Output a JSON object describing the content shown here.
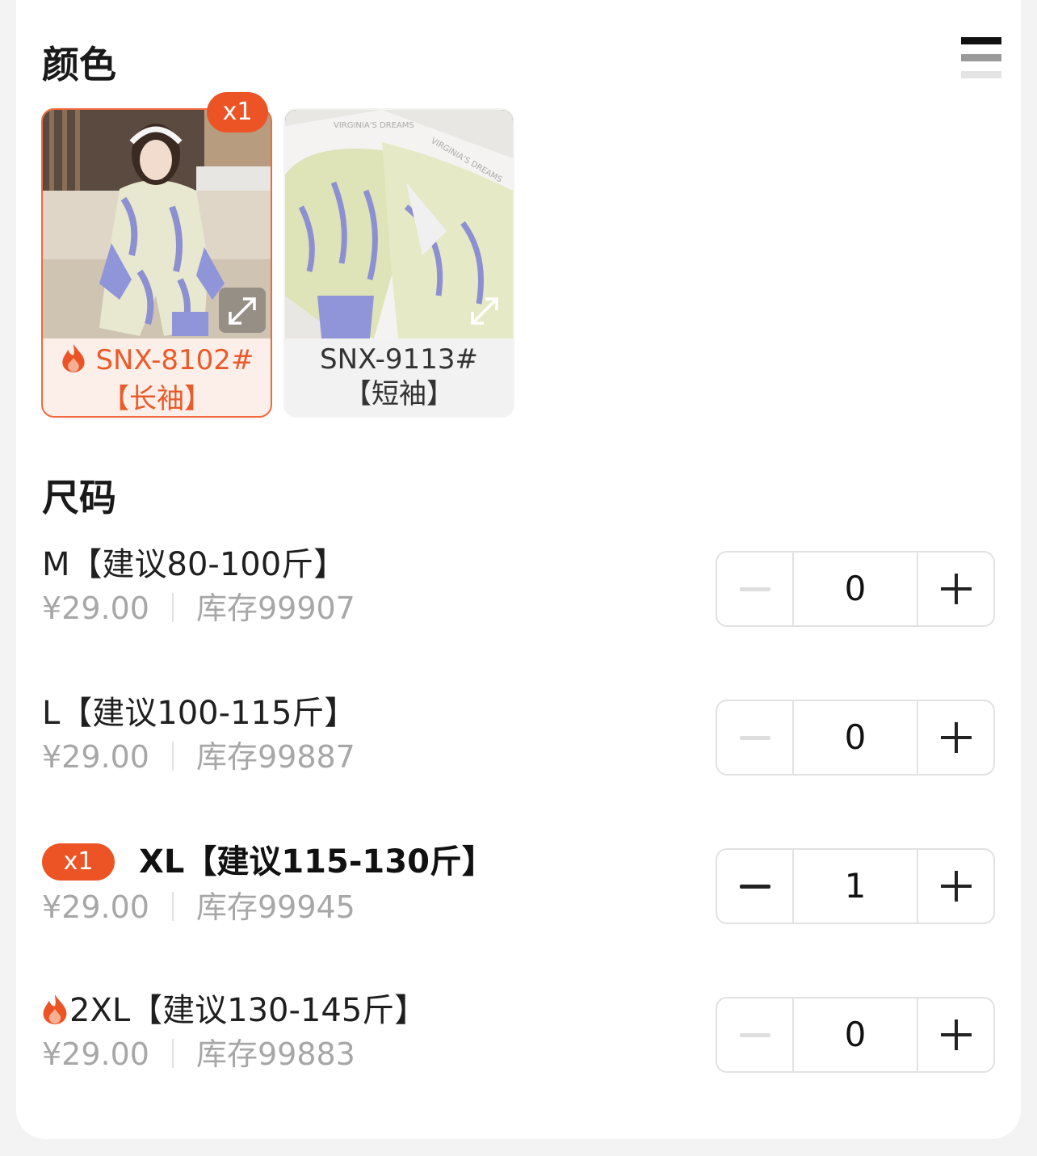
{
  "color_section": {
    "title": "颜色",
    "options": [
      {
        "label_line1": "SNX-8102#",
        "label_line2": "【长袖】",
        "selected": true,
        "count_badge": "x1",
        "hot": true,
        "image": "model-in-long-sleeve-pajamas"
      },
      {
        "label_line1": "SNX-9113#",
        "label_line2": "【短袖】",
        "selected": false,
        "hot": false,
        "image": "boxed-short-sleeve-pajamas"
      }
    ]
  },
  "size_section": {
    "title": "尺码",
    "rows": [
      {
        "name": "M【建议80-100斤】",
        "price": "¥29.00",
        "stock": "库存99907",
        "quantity": "0",
        "badge": "",
        "hot": false
      },
      {
        "name": "L【建议100-115斤】",
        "price": "¥29.00",
        "stock": "库存99887",
        "quantity": "0",
        "badge": "",
        "hot": false
      },
      {
        "name": "XL【建议115-130斤】",
        "price": "¥29.00",
        "stock": "库存99945",
        "quantity": "1",
        "badge": "x1",
        "hot": false
      },
      {
        "name": "2XL【建议130-145斤】",
        "price": "¥29.00",
        "stock": "库存99883",
        "quantity": "0",
        "badge": "",
        "hot": true
      }
    ]
  },
  "icons": {
    "hot": "fire-icon",
    "expand": "expand-arrows-icon",
    "list_toggle": "list-view-icon",
    "minus": "minus-icon",
    "plus": "plus-icon"
  },
  "colors": {
    "accent": "#EC5425",
    "accent_text": "#EA5B2A",
    "selected_bg": "#FCEFE9",
    "muted_text": "#A7A7A7",
    "border": "#E2E2E2"
  }
}
